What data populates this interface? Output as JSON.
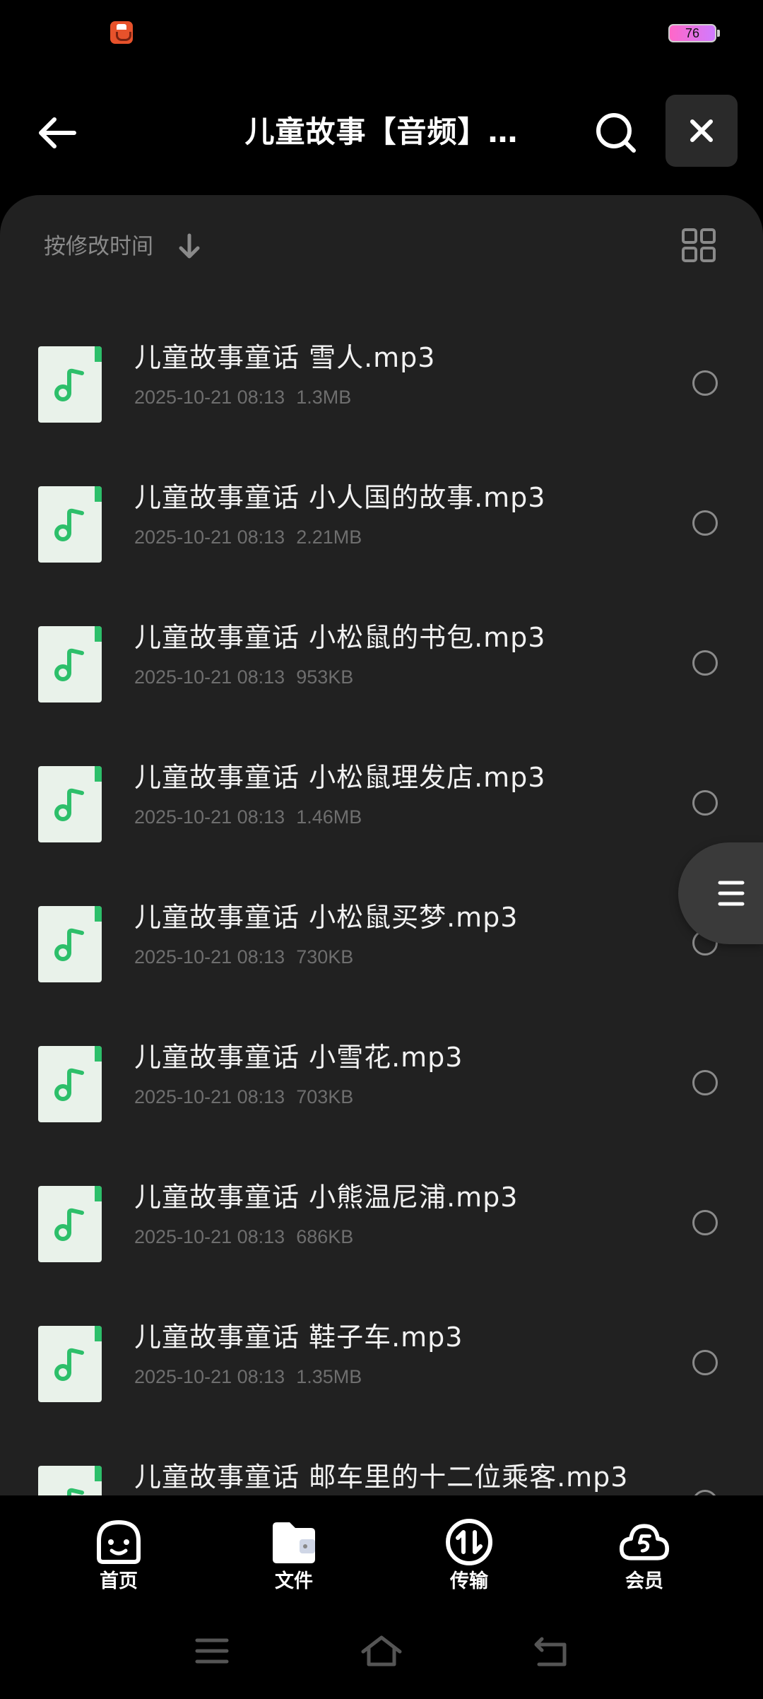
{
  "status_bar": {
    "app_icon": "game-center-icon",
    "battery_level": "76"
  },
  "header": {
    "title": "儿童故事【音频】…",
    "back_icon": "arrow-left-icon",
    "search_icon": "search-icon",
    "close_icon": "close-icon"
  },
  "toolbar": {
    "sort_label": "按修改时间",
    "sort_icon": "arrow-down-icon",
    "view_icon": "grid-view-icon"
  },
  "files": [
    {
      "name": "儿童故事童话 雪人.mp3",
      "date": "2025-10-21 08:13",
      "size": "1.3MB"
    },
    {
      "name": "儿童故事童话 小人国的故事.mp3",
      "date": "2025-10-21 08:13",
      "size": "2.21MB"
    },
    {
      "name": "儿童故事童话 小松鼠的书包.mp3",
      "date": "2025-10-21 08:13",
      "size": "953KB"
    },
    {
      "name": "儿童故事童话 小松鼠理发店.mp3",
      "date": "2025-10-21 08:13",
      "size": "1.46MB"
    },
    {
      "name": "儿童故事童话 小松鼠买梦.mp3",
      "date": "2025-10-21 08:13",
      "size": "730KB"
    },
    {
      "name": "儿童故事童话 小雪花.mp3",
      "date": "2025-10-21 08:13",
      "size": "703KB"
    },
    {
      "name": "儿童故事童话 小熊温尼浦.mp3",
      "date": "2025-10-21 08:13",
      "size": "686KB"
    },
    {
      "name": "儿童故事童话 鞋子车.mp3",
      "date": "2025-10-21 08:13",
      "size": "1.35MB"
    },
    {
      "name": "儿童故事童话 邮车里的十二位乘客.mp3",
      "date": "",
      "size": ""
    }
  ],
  "side_handle": {
    "icon": "menu-lines-icon"
  },
  "tabs": [
    {
      "label": "首页",
      "icon": "smiley-home-icon"
    },
    {
      "label": "文件",
      "icon": "folder-icon"
    },
    {
      "label": "传输",
      "icon": "transfer-icon"
    },
    {
      "label": "会员",
      "icon": "cloud-vip-icon"
    }
  ],
  "nav": {
    "menu_icon": "menu-icon",
    "home_icon": "home-icon",
    "back_icon": "back-icon"
  },
  "colors": {
    "background": "#000000",
    "panel": "#212121",
    "accent_green": "#2dbf6a",
    "text_secondary": "#6e6e6e"
  }
}
